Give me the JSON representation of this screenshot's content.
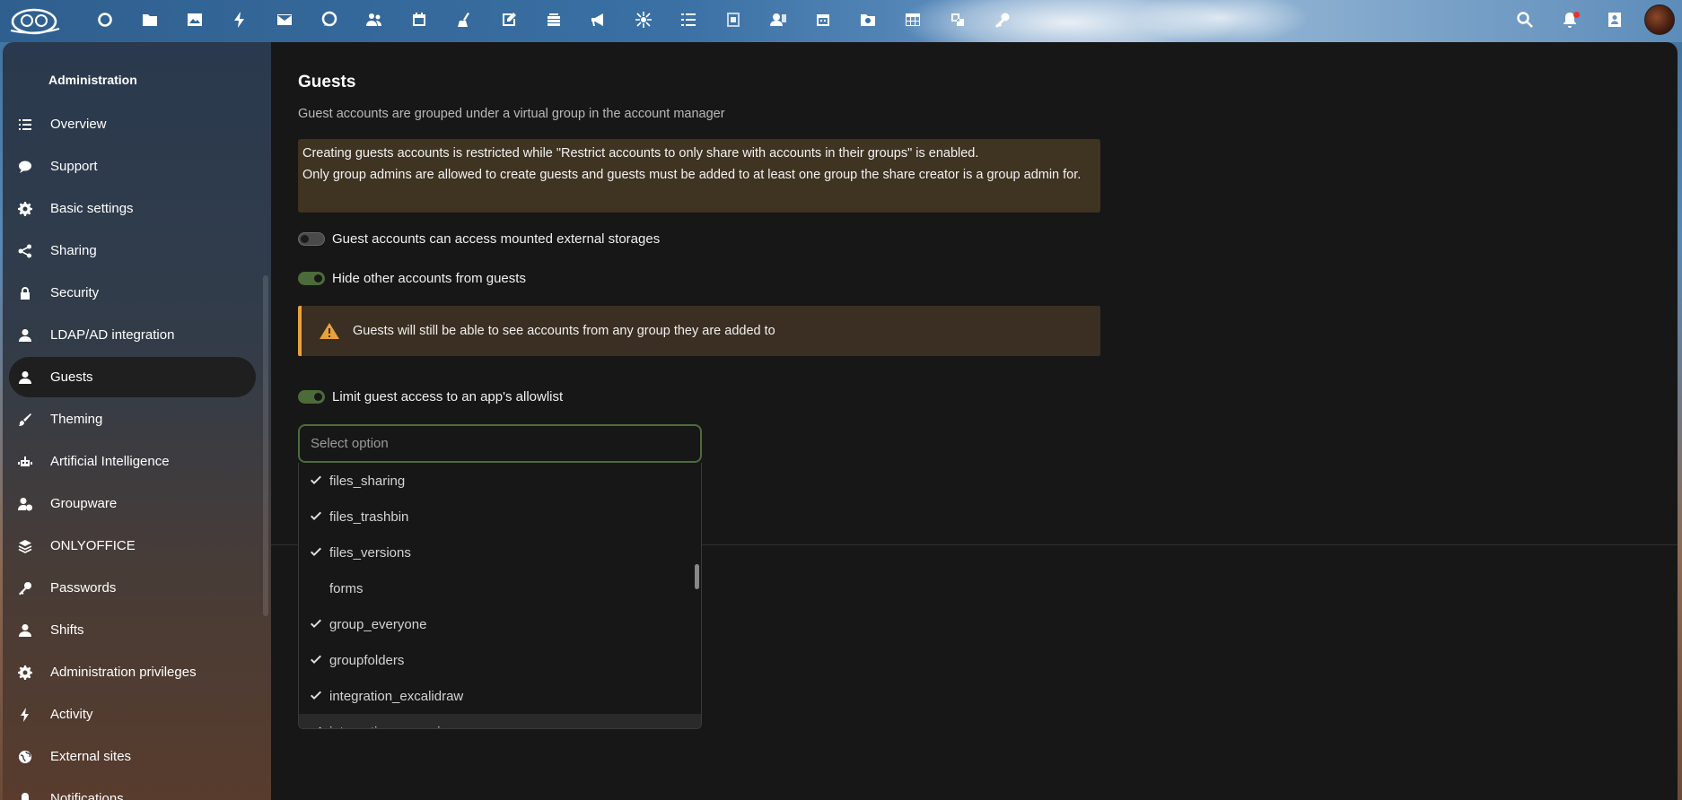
{
  "topbar": {
    "apps": [
      {
        "name": "dashboard-app",
        "icon": "circle-icon"
      },
      {
        "name": "files-app",
        "icon": "folder-icon"
      },
      {
        "name": "photos-app",
        "icon": "image-icon"
      },
      {
        "name": "activity-app",
        "icon": "lightning-icon"
      },
      {
        "name": "mail-app",
        "icon": "mail-icon"
      },
      {
        "name": "talk-app",
        "icon": "chat-bubble-icon"
      },
      {
        "name": "contacts-app",
        "icon": "contacts-icon"
      },
      {
        "name": "calendar-app",
        "icon": "calendar-icon"
      },
      {
        "name": "cleanup-app",
        "icon": "broom-icon"
      },
      {
        "name": "notes-app",
        "icon": "edit-icon"
      },
      {
        "name": "deck-app",
        "icon": "layers-icon"
      },
      {
        "name": "announcements-app",
        "icon": "megaphone-icon"
      },
      {
        "name": "spreed-app",
        "icon": "star-network-icon"
      },
      {
        "name": "tasks-app",
        "icon": "checklist-icon"
      },
      {
        "name": "forms-app",
        "icon": "form-icon"
      },
      {
        "name": "guests-app",
        "icon": "user-card-icon"
      },
      {
        "name": "calendar2-app",
        "icon": "calendar-grid-icon"
      },
      {
        "name": "photo-folder-app",
        "icon": "photo-folder-icon"
      },
      {
        "name": "tables-app",
        "icon": "table-icon"
      },
      {
        "name": "integrations-app",
        "icon": "integration-icon"
      },
      {
        "name": "passwords-app",
        "icon": "key-icon"
      }
    ]
  },
  "sidebar": {
    "title": "Administration",
    "items": [
      {
        "label": "Overview",
        "icon": "list-icon"
      },
      {
        "label": "Support",
        "icon": "chat-icon"
      },
      {
        "label": "Basic settings",
        "icon": "gear-icon"
      },
      {
        "label": "Sharing",
        "icon": "share-icon"
      },
      {
        "label": "Security",
        "icon": "lock-icon"
      },
      {
        "label": "LDAP/AD integration",
        "icon": "person-icon"
      },
      {
        "label": "Guests",
        "icon": "person-icon"
      },
      {
        "label": "Theming",
        "icon": "brush-icon"
      },
      {
        "label": "Artificial Intelligence",
        "icon": "robot-icon"
      },
      {
        "label": "Groupware",
        "icon": "person-clock-icon"
      },
      {
        "label": "ONLYOFFICE",
        "icon": "layers-icon"
      },
      {
        "label": "Passwords",
        "icon": "key-icon"
      },
      {
        "label": "Shifts",
        "icon": "person-icon"
      },
      {
        "label": "Administration privileges",
        "icon": "gear-icon"
      },
      {
        "label": "Activity",
        "icon": "lightning-icon"
      },
      {
        "label": "External sites",
        "icon": "globe-icon"
      },
      {
        "label": "Notifications",
        "icon": "bell-icon"
      }
    ],
    "active": "Guests"
  },
  "main": {
    "title": "Guests",
    "description": "Guest accounts are grouped under a virtual group in the account manager",
    "info_line1": "Creating guests accounts is restricted while \"Restrict accounts to only share with accounts in their groups\" is enabled.",
    "info_line2": "Only group admins are allowed to create guests and guests must be added to at least one group the share creator is a group admin for.",
    "toggle_external_storage": {
      "label": "Guest accounts can access mounted external storages",
      "checked": false
    },
    "toggle_hide_accounts": {
      "label": "Hide other accounts from guests",
      "checked": true
    },
    "warning_text": "Guests will still be able to see accounts from any group they are added to",
    "toggle_allowlist": {
      "label": "Limit guest access to an app's allowlist",
      "checked": true
    },
    "select_placeholder": "Select option",
    "options": [
      {
        "label": "files_sharing",
        "checked": true
      },
      {
        "label": "files_trashbin",
        "checked": true
      },
      {
        "label": "files_versions",
        "checked": true
      },
      {
        "label": "forms",
        "checked": false
      },
      {
        "label": "group_everyone",
        "checked": true
      },
      {
        "label": "groupfolders",
        "checked": true
      },
      {
        "label": "integration_excalidraw",
        "checked": true
      },
      {
        "label": "integration_openai",
        "checked": true
      }
    ]
  },
  "colors": {
    "accent_toggle": "#4c6b3a",
    "warning_border": "#e9a23b",
    "info_bg": "#3f3321",
    "main_bg": "#171717"
  }
}
